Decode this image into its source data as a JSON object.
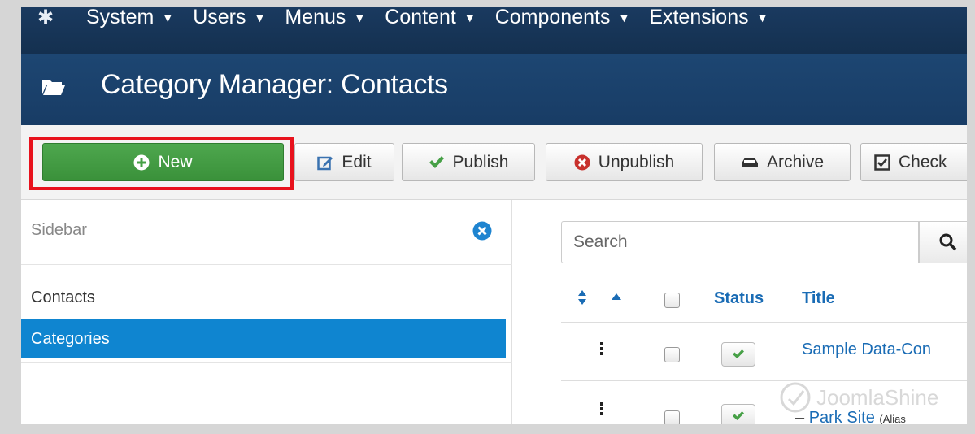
{
  "nav": {
    "items": [
      {
        "label": "System"
      },
      {
        "label": "Users"
      },
      {
        "label": "Menus"
      },
      {
        "label": "Content"
      },
      {
        "label": "Components"
      },
      {
        "label": "Extensions"
      }
    ],
    "logo_icon": "joomla-logo-icon"
  },
  "header": {
    "title": "Category Manager: Contacts",
    "icon": "folder-open-icon"
  },
  "toolbar": {
    "new_label": "New",
    "edit_label": "Edit",
    "publish_label": "Publish",
    "unpublish_label": "Unpublish",
    "archive_label": "Archive",
    "checkin_label": "Check"
  },
  "sidebar": {
    "label": "Sidebar",
    "items": [
      {
        "label": "Contacts",
        "active": false
      },
      {
        "label": "Categories",
        "active": true
      }
    ]
  },
  "main": {
    "search": {
      "placeholder": "Search"
    },
    "table": {
      "headers": {
        "status": "Status",
        "title": "Title"
      },
      "rows": [
        {
          "title": "Sample Data-Con",
          "alias": "",
          "published": true
        },
        {
          "title": "Park Site",
          "alias": "(Alias",
          "prefix": "–",
          "published": true
        }
      ]
    }
  },
  "watermark": "JoomlaShine",
  "colors": {
    "navbar": "#17385e",
    "header": "#1b426c",
    "new_button": "#46a046",
    "highlight": "#e8121d",
    "active_sidebar": "#0f85d0",
    "link": "#1a6cb5"
  }
}
